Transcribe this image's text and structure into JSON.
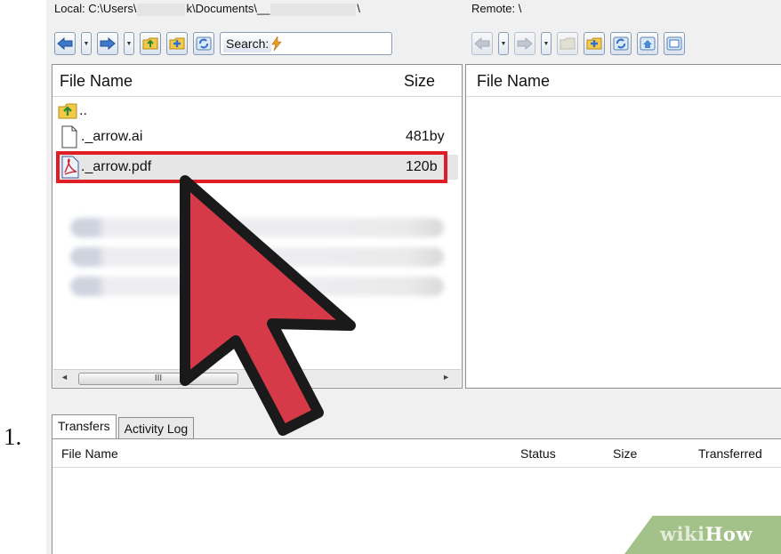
{
  "list_marker": "1.",
  "local": {
    "label_start": "Local: C:\\Users\\",
    "label_mid": "k\\Documents\\__",
    "label_end": "\\"
  },
  "remote": {
    "label": "Remote: \\"
  },
  "search": {
    "label": "Search:"
  },
  "local_list": {
    "headers": {
      "name": "File Name",
      "size": "Size"
    },
    "parent_dir": "..",
    "files": [
      {
        "name": "._arrow.ai",
        "size": "481by"
      },
      {
        "name": "._arrow.pdf",
        "size": "120b"
      }
    ],
    "scroll_thumb": "III"
  },
  "remote_list": {
    "headers": {
      "name": "File Name"
    }
  },
  "bottom_tabs": [
    "Transfers",
    "Activity Log"
  ],
  "transfers": {
    "headers": {
      "name": "File Name",
      "status": "Status",
      "size": "Size",
      "transferred": "Transferred"
    }
  },
  "watermark": {
    "wiki": "wiki",
    "how": "How"
  },
  "colors": {
    "highlight": "#e01e25",
    "cursor": "#d63a48",
    "watermark": "#a3c28a"
  },
  "icons": [
    "back-arrow-icon",
    "forward-arrow-icon",
    "new-folder-icon",
    "add-icon",
    "refresh-icon",
    "home-icon",
    "window-icon",
    "folder-up-icon",
    "file-icon",
    "pdf-icon",
    "cursor-arrow-icon"
  ]
}
